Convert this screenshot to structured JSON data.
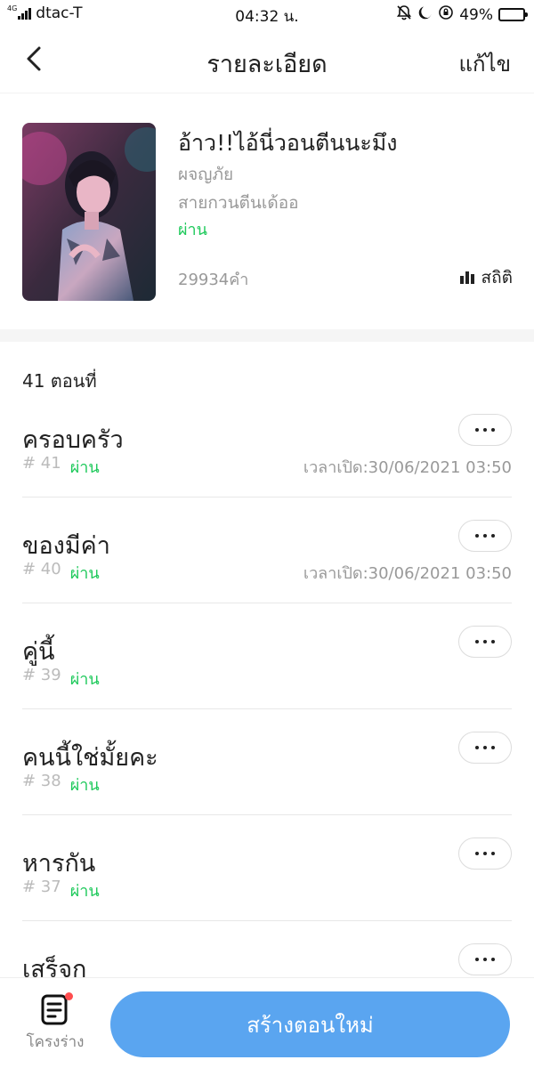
{
  "status_bar": {
    "network": "4G",
    "carrier": "dtac-T",
    "time": "04:32 น.",
    "battery": "49%",
    "battery_level": 0.49
  },
  "nav": {
    "title": "รายละเอียด",
    "edit_label": "แก้ไข"
  },
  "book": {
    "title": "อ้าว!!ไอ้นี่วอนตีนนะมึง",
    "author": "ผจญภัย",
    "genre": "สายกวนตีนเด้ออ",
    "status": "ผ่าน",
    "word_count": "29934คำ",
    "stats_label": "สถิติ"
  },
  "chapter_count": "41 ตอนที่",
  "chapters": [
    {
      "title": "ครอบครัว",
      "number": "# 41",
      "status": "ผ่าน",
      "time": "เวลาเปิด:30/06/2021 03:50"
    },
    {
      "title": "ของมีค่า",
      "number": "# 40",
      "status": "ผ่าน",
      "time": "เวลาเปิด:30/06/2021 03:50"
    },
    {
      "title": "คู่นี้",
      "number": "# 39",
      "status": "ผ่าน",
      "time": ""
    },
    {
      "title": "คนนี้ใช่มั้ยคะ",
      "number": "# 38",
      "status": "ผ่าน",
      "time": ""
    },
    {
      "title": "หารกัน",
      "number": "# 37",
      "status": "ผ่าน",
      "time": ""
    },
    {
      "title": "เสร็จกู",
      "number": "",
      "status": "",
      "time": ""
    }
  ],
  "bottom": {
    "draft_label": "โครงร่าง",
    "create_label": "สร้างตอนใหม่"
  },
  "colors": {
    "accent": "#5aa5f0",
    "status_green": "#1ec95b",
    "notification_dot": "#ff4d4f"
  }
}
